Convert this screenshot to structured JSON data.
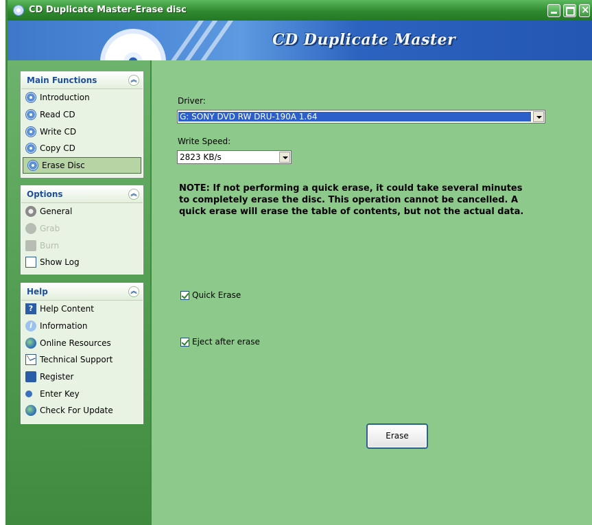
{
  "window": {
    "title": "CD Duplicate Master-Erase disc"
  },
  "banner": {
    "brand": "CD Duplicate Master"
  },
  "sidebar": {
    "main_functions": {
      "title": "Main Functions",
      "items": [
        {
          "label": "Introduction",
          "icon": "disc-icon"
        },
        {
          "label": "Read CD",
          "icon": "disc-icon"
        },
        {
          "label": "Write CD",
          "icon": "disc-icon"
        },
        {
          "label": "Copy CD",
          "icon": "disc-icon"
        },
        {
          "label": "Erase Disc",
          "icon": "disc-icon",
          "selected": true
        }
      ]
    },
    "options": {
      "title": "Options",
      "items": [
        {
          "label": "General",
          "icon": "gear-icon"
        },
        {
          "label": "Grab",
          "icon": "grab-icon",
          "disabled": true
        },
        {
          "label": "Burn",
          "icon": "burn-icon",
          "disabled": true
        },
        {
          "label": "Show Log",
          "icon": "log-icon"
        }
      ]
    },
    "help": {
      "title": "Help",
      "items": [
        {
          "label": "Help Content",
          "icon": "help-icon",
          "glyph": "?"
        },
        {
          "label": "Information",
          "icon": "info-icon",
          "glyph": "i"
        },
        {
          "label": "Online Resources",
          "icon": "globe-icon"
        },
        {
          "label": "Technical Support",
          "icon": "mail-icon"
        },
        {
          "label": "Register",
          "icon": "register-icon"
        },
        {
          "label": "Enter Key",
          "icon": "key-icon"
        },
        {
          "label": "Check For Update",
          "icon": "update-icon"
        }
      ]
    }
  },
  "form": {
    "driver_label": "Driver:",
    "driver_value": "G: SONY DVD RW DRU-190A 1.64",
    "speed_label": "Write Speed:",
    "speed_value": "2823 KB/s",
    "note": "NOTE: If not performing a quick erase, it could take several minutes to completely erase the disc. This operation cannot be cancelled. A quick erase will erase the table of contents, but not the actual data.",
    "quick_erase_label": "Quick Erase",
    "quick_erase_checked": true,
    "eject_label": "Eject after erase",
    "eject_checked": true,
    "erase_button": "Erase"
  },
  "colors": {
    "title_bar": "#2f8a2f",
    "content_bg": "#8dc98a",
    "selection": "#2c5fc9",
    "banner": "#2d63c0"
  }
}
